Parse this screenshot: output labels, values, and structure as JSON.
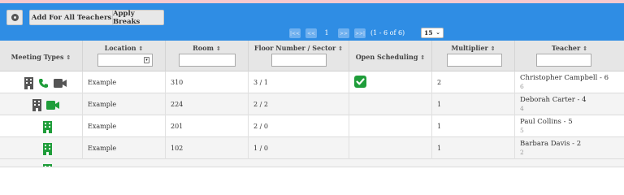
{
  "toolbar": {
    "add_all_label": "Add For All Teachers",
    "apply_breaks_label": "Apply Breaks"
  },
  "paginator": {
    "first": "|<<",
    "prev": "<<",
    "page": "1",
    "next": ">>",
    "last": ">>|",
    "report": "(1 - 6 of 6)",
    "rows_per_page": "15"
  },
  "columns": {
    "meeting_types": "Meeting Types",
    "location": "Location",
    "room": "Room",
    "floor": "Floor Number / Sector",
    "open_scheduling": "Open Scheduling",
    "multiplier": "Multiplier",
    "teacher": "Teacher"
  },
  "rows": [
    {
      "location": "Example",
      "room": "310",
      "floor": "3 / 1",
      "open": true,
      "multiplier": "2",
      "teacher": "Christopher Campbell - 6",
      "teacher_id": "6",
      "types": [
        "building",
        "phone",
        "video"
      ]
    },
    {
      "location": "Example",
      "room": "224",
      "floor": "2 / 2",
      "open": false,
      "multiplier": "1",
      "teacher": "Deborah Carter - 4",
      "teacher_id": "4",
      "types": [
        "building",
        "video"
      ]
    },
    {
      "location": "Example",
      "room": "201",
      "floor": "2 / 0",
      "open": false,
      "multiplier": "1",
      "teacher": "Paul Collins - 5",
      "teacher_id": "5",
      "types": [
        "building"
      ]
    },
    {
      "location": "Example",
      "room": "102",
      "floor": "1 / 0",
      "open": false,
      "multiplier": "1",
      "teacher": "Barbara Davis - 2",
      "teacher_id": "2",
      "types": [
        "building"
      ]
    }
  ],
  "colors": {
    "header_blue": "#2f8de4",
    "icon_green": "#1f9d3a",
    "icon_gray": "#555555"
  }
}
